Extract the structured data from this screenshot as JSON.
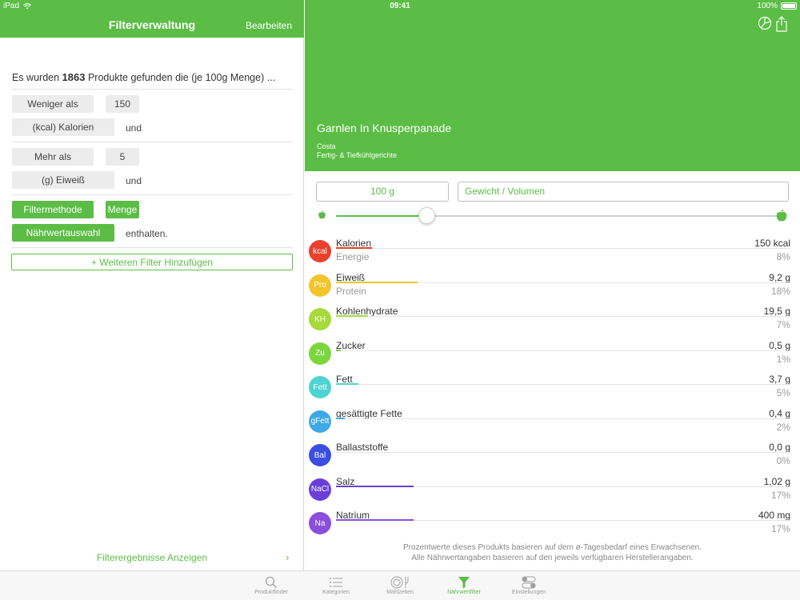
{
  "status_bar": {
    "device": "iPad",
    "time": "09:41",
    "battery": "100%"
  },
  "filter_panel": {
    "title": "Filterverwaltung",
    "edit_label": "Bearbeiten",
    "summary_prefix": "Es wurden",
    "summary_count": "1863",
    "summary_suffix": "Produkte gefunden die (je 100g Menge) ...",
    "filter1": {
      "operator": "Weniger als",
      "value": "150",
      "nutrient": "(kcal) Kalorien",
      "conjunction": "und"
    },
    "filter2": {
      "operator": "Mehr als",
      "value": "5",
      "nutrient": "(g) Eiweiß",
      "conjunction": "und"
    },
    "filter3": {
      "method_label": "Filtermethode",
      "method_value": "Menge",
      "selection_label": "Nährwertauswahl",
      "suffix": "enthalten."
    },
    "add_filter_label": "+ Weiteren Filter Hinzufügen",
    "show_results_label": "Filterergebnisse Anzeigen"
  },
  "product": {
    "name": "Garnlen In Knusperpanade",
    "brand": "Costa",
    "category": "Fertig- & Tiefkühlgerichte",
    "amount": "100 g",
    "unit": "Gewicht / Volumen",
    "slider_fraction": 0.205,
    "nutrients": [
      {
        "abbr": "kcal",
        "name": "Kalorien",
        "sub": "Energie",
        "value": "150 kcal",
        "pct": "8%",
        "pct_num": 8,
        "color": "#e8402c"
      },
      {
        "abbr": "Pro",
        "name": "Eiweiß",
        "sub": "Protein",
        "value": "9,2 g",
        "pct": "18%",
        "pct_num": 18,
        "color": "#f3c52d"
      },
      {
        "abbr": "KH",
        "name": "Kohlenhydrate",
        "sub": "",
        "value": "19,5 g",
        "pct": "7%",
        "pct_num": 7,
        "color": "#a6d93a"
      },
      {
        "abbr": "Zu",
        "name": "Zucker",
        "sub": "",
        "value": "0,5 g",
        "pct": "1%",
        "pct_num": 1,
        "color": "#7bd63e"
      },
      {
        "abbr": "Fett",
        "name": "Fett",
        "sub": "",
        "value": "3,7 g",
        "pct": "5%",
        "pct_num": 5,
        "color": "#4fd3d0"
      },
      {
        "abbr": "gFett",
        "name": "gesättigte Fette",
        "sub": "",
        "value": "0,4 g",
        "pct": "2%",
        "pct_num": 2,
        "color": "#3fa9e8"
      },
      {
        "abbr": "Bal",
        "name": "Ballaststoffe",
        "sub": "",
        "value": "0,0 g",
        "pct": "0%",
        "pct_num": 0,
        "color": "#3a4fe0"
      },
      {
        "abbr": "NaCl",
        "name": "Salz",
        "sub": "",
        "value": "1,02 g",
        "pct": "17%",
        "pct_num": 17,
        "color": "#6a3fd9"
      },
      {
        "abbr": "Na",
        "name": "Natrium",
        "sub": "",
        "value": "400 mg",
        "pct": "17%",
        "pct_num": 17,
        "color": "#8b4fdb"
      }
    ],
    "footnote_1": "Prozentwerte dieses Produkts basieren auf dem ø-Tagesbedarf eines Erwachsenen.",
    "footnote_2": "Alle Nährwertangaben basieren auf den jeweils verfügbaren Herstellerangaben."
  },
  "tabs": [
    {
      "label": "Produktfinder",
      "icon": "search-icon",
      "active": false
    },
    {
      "label": "Kategorien",
      "icon": "list-icon",
      "active": false
    },
    {
      "label": "Mahlzeiten",
      "icon": "plate-icon",
      "active": false
    },
    {
      "label": "Nährwertfilter",
      "icon": "funnel-icon",
      "active": true
    },
    {
      "label": "Einstellungen",
      "icon": "toggles-icon",
      "active": false
    }
  ],
  "colors": {
    "accent": "#5bbd45"
  }
}
